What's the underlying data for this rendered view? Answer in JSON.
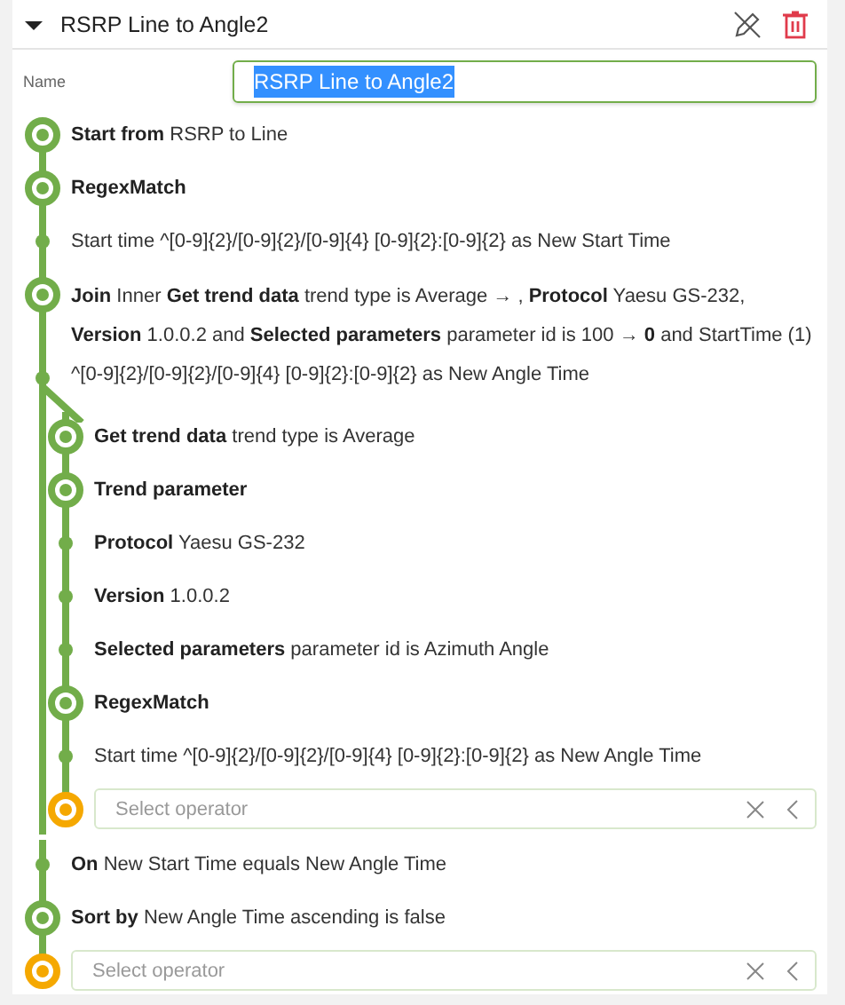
{
  "header": {
    "title": "RSRP Line to Angle2",
    "expanded": true
  },
  "name_field": {
    "label": "Name",
    "value": "RSRP Line to Angle2",
    "text_selected": true
  },
  "steps": [
    {
      "kind": "node",
      "text": "**Start from** RSRP to Line"
    },
    {
      "kind": "node",
      "text": "**RegexMatch**"
    },
    {
      "kind": "point",
      "text": "Start time ^[0-9]{2}/[0-9]{2}/[0-9]{4} [0-9]{2}:[0-9]{2} as New Start Time"
    },
    {
      "kind": "node",
      "text": "**Join** Inner **Get trend data** trend type is Average → , **Protocol** Yaesu GS-232, **Version** 1.0.0.2 and **Selected parameters** parameter id is 100 → **0** and StartTime (1) ^[0-9]{2}/[0-9]{2}/[0-9]{4} [0-9]{2}:[0-9]{2} as New Angle Time",
      "children": [
        {
          "kind": "node",
          "text": "**Get trend data** trend type is Average"
        },
        {
          "kind": "node",
          "text": "**Trend parameter**"
        },
        {
          "kind": "point",
          "text": "**Protocol** Yaesu GS-232"
        },
        {
          "kind": "point",
          "text": "**Version** 1.0.0.2"
        },
        {
          "kind": "point",
          "text": "**Selected parameters** parameter id is Azimuth Angle"
        },
        {
          "kind": "node",
          "text": "**RegexMatch**"
        },
        {
          "kind": "point",
          "text": "Start time ^[0-9]{2}/[0-9]{2}/[0-9]{4} [0-9]{2}:[0-9]{2} as New Angle Time"
        },
        {
          "kind": "select",
          "placeholder": "Select operator"
        }
      ]
    },
    {
      "kind": "point",
      "text": "**On** New Start Time equals New Angle Time"
    },
    {
      "kind": "node",
      "text": "**Sort by** New Angle Time ascending is false"
    },
    {
      "kind": "select",
      "placeholder": "Select operator"
    }
  ]
}
